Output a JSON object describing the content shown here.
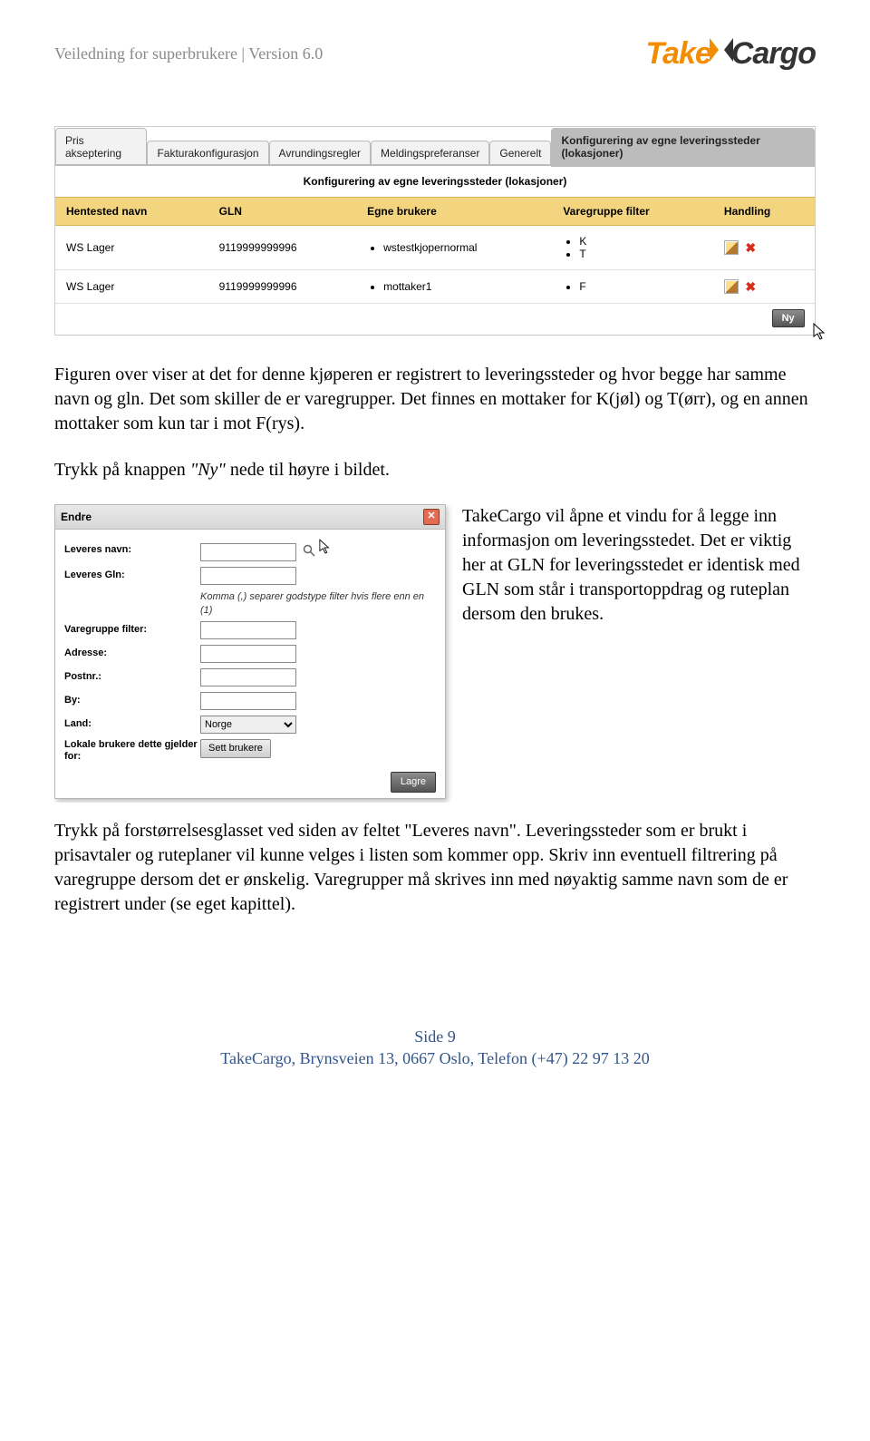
{
  "header": {
    "text": "Veiledning for superbrukere | Version 6.0"
  },
  "logo": {
    "take": "Take",
    "cargo": "Cargo"
  },
  "shot1": {
    "tabs": [
      {
        "label": "Pris akseptering"
      },
      {
        "label": "Fakturakonfigurasjon"
      },
      {
        "label": "Avrundingsregler"
      },
      {
        "label": "Meldingspreferanser"
      },
      {
        "label": "Generelt"
      },
      {
        "label": "Konfigurering av egne leveringssteder (lokasjoner)"
      }
    ],
    "active_tab_index": 5,
    "panel_title": "Konfigurering av egne leveringssteder (lokasjoner)",
    "columns": [
      "Hentested navn",
      "GLN",
      "Egne brukere",
      "Varegruppe filter",
      "Handling"
    ],
    "rows": [
      {
        "navn": "WS Lager",
        "gln": "9119999999996",
        "brukere": [
          "wstestkjopernormal"
        ],
        "filter": [
          "K",
          "T"
        ]
      },
      {
        "navn": "WS Lager",
        "gln": "9119999999996",
        "brukere": [
          "mottaker1"
        ],
        "filter": [
          "F"
        ]
      }
    ],
    "ny_label": "Ny"
  },
  "paras": {
    "p1a": "Figuren over viser at det for denne kjøperen er registrert to leveringssteder og hvor begge har samme navn og gln. Det som skiller de er varegrupper. Det finnes en mottaker for K(jøl) og T(ørr), og en annen mottaker som kun tar i mot F(rys).",
    "p2_pre": "Trykk på knappen ",
    "p2_em": "\"Ny\"",
    "p2_post": " nede til høyre i bildet.",
    "p3_lead": "TakeCargo vil åpne et vindu for å legge inn ",
    "p3_rest": "informasjon om leveringsstedet. Det er viktig her at GLN for leveringsstedet er identisk med GLN som står i transportoppdrag og ruteplan dersom den brukes.",
    "p4": "Trykk på forstørrelsesglasset ved siden av feltet \"Leveres navn\". Leveringssteder som er brukt i prisavtaler og ruteplaner vil kunne velges i listen som kommer opp. Skriv inn eventuell filtrering på varegruppe dersom det er ønskelig. Varegrupper må skrives inn med nøyaktig samme navn som de er registrert under (se eget kapittel)."
  },
  "dialog": {
    "title": "Endre",
    "fields": {
      "leveres_navn": "Leveres navn:",
      "leveres_gln": "Leveres Gln:",
      "hint": "Komma (,) separer godstype filter hvis flere enn en (1)",
      "varegruppe": "Varegruppe filter:",
      "adresse": "Adresse:",
      "postnr": "Postnr.:",
      "by": "By:",
      "land_label": "Land:",
      "land_value": "Norge",
      "lokale": "Lokale brukere dette gjelder for:",
      "sett_brukere": "Sett brukere",
      "lagre": "Lagre"
    }
  },
  "footer": {
    "line1": "Side 9",
    "line2": "TakeCargo, Brynsveien 13, 0667 Oslo, Telefon (+47)  22 97 13 20"
  }
}
